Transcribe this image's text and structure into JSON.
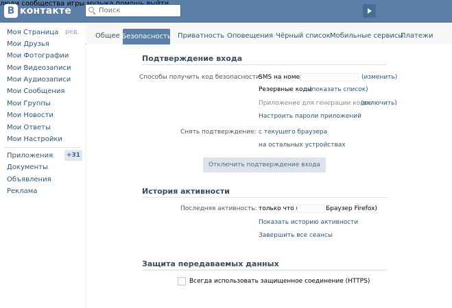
{
  "header": {
    "logo_letter": "В",
    "logo_text": "контакте",
    "search_placeholder": "Поиск",
    "nav": [
      "люди",
      "сообщества",
      "игры",
      "музыка",
      "помощь",
      "выйти"
    ]
  },
  "sidebar": {
    "items": [
      "Моя Страница",
      "Мои Друзья",
      "Мои Фотографии",
      "Мои Видеозаписи",
      "Мои Аудиозаписи",
      "Мои Сообщения",
      "Мои Группы",
      "Мои Новости",
      "Мои Ответы",
      "Мои Настройки"
    ],
    "edit": "ред.",
    "extra": [
      "Приложения",
      "Документы",
      "Объявления",
      "Реклама"
    ],
    "apps_badge": "+31"
  },
  "tabs": [
    "Общее",
    "Безопасность",
    "Приватность",
    "Оповещения",
    "Чёрный список",
    "Мобильные сервисы",
    "Платежи"
  ],
  "login_confirm": {
    "title": "Подтверждение входа",
    "methods_label": "Способы получить код безопасности:",
    "sms": "SMS на номер",
    "change": "(изменить)",
    "backup": "Резервные коды",
    "show_list": "(показать список)",
    "app_gen": "Приложение для генерации кодов",
    "enable": "(включить)",
    "app_passwords": "Настроить пароли приложений",
    "remove_label": "Снять подтверждение:",
    "from_browser": "с текущего браузера",
    "other_devices": "на остальных устройствах",
    "disable_button": "Отключить подтверждение входа"
  },
  "activity": {
    "title": "История активности",
    "last_label": "Последняя активность:",
    "just_now": "только что (",
    "browser": "Браузер Firefox)",
    "show_history": "Показать историю активности",
    "end_sessions": "Завершить все сеансы"
  },
  "protection": {
    "title": "Защита передаваемых данных",
    "https_label": "Всегда использовать защищенное соединение (HTTPS)"
  }
}
